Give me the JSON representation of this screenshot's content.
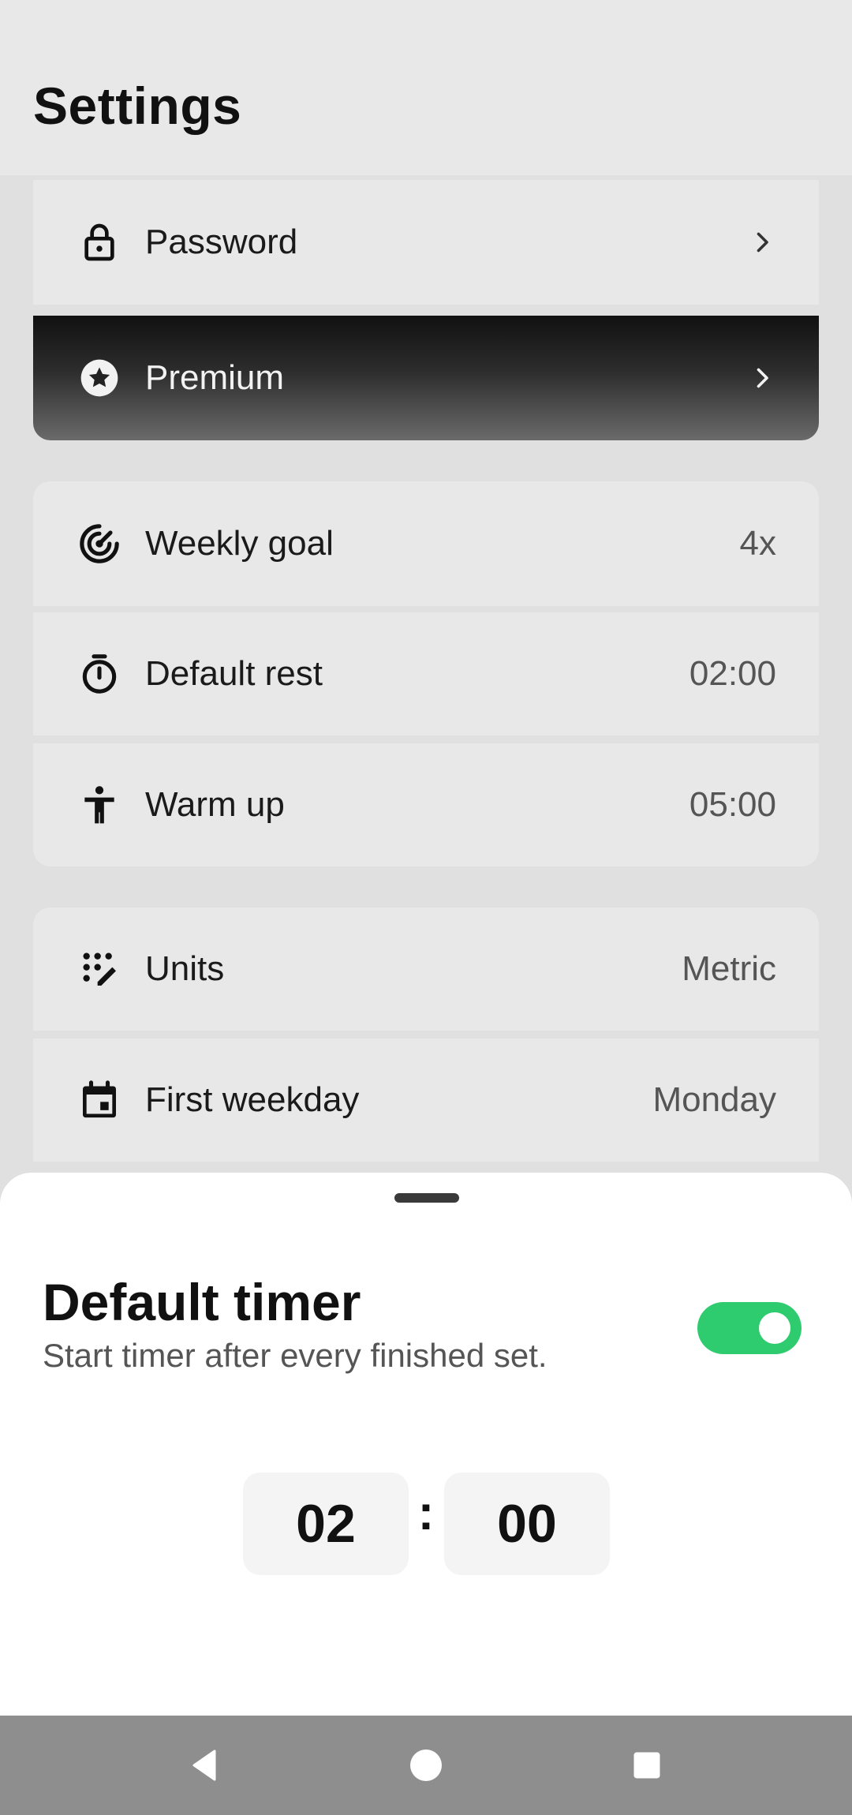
{
  "header": {
    "title": "Settings"
  },
  "account_rows": [
    {
      "label": "Password",
      "icon": "lock-icon"
    },
    {
      "label": "Premium",
      "icon": "star-circle-icon"
    }
  ],
  "training_rows": [
    {
      "label": "Weekly goal",
      "value": "4x",
      "icon": "target-icon"
    },
    {
      "label": "Default rest",
      "value": "02:00",
      "icon": "stopwatch-icon"
    },
    {
      "label": "Warm up",
      "value": "05:00",
      "icon": "person-icon"
    }
  ],
  "general_rows": [
    {
      "label": "Units",
      "value": "Metric",
      "icon": "ruler-dots-icon"
    },
    {
      "label": "First weekday",
      "value": "Monday",
      "icon": "calendar-icon"
    }
  ],
  "sheet": {
    "title": "Default timer",
    "subtitle": "Start timer after every finished set.",
    "toggle_on": true,
    "minutes": "02",
    "separator": ":",
    "seconds": "00"
  },
  "colors": {
    "toggle_on": "#2ecc6f",
    "background": "#e0e0e0",
    "row": "#e8e8e8",
    "premium_gradient_top": "#111111",
    "navbar": "#8e8e8e"
  },
  "navbar": {
    "buttons": [
      "back-icon",
      "home-icon",
      "recents-icon"
    ]
  }
}
